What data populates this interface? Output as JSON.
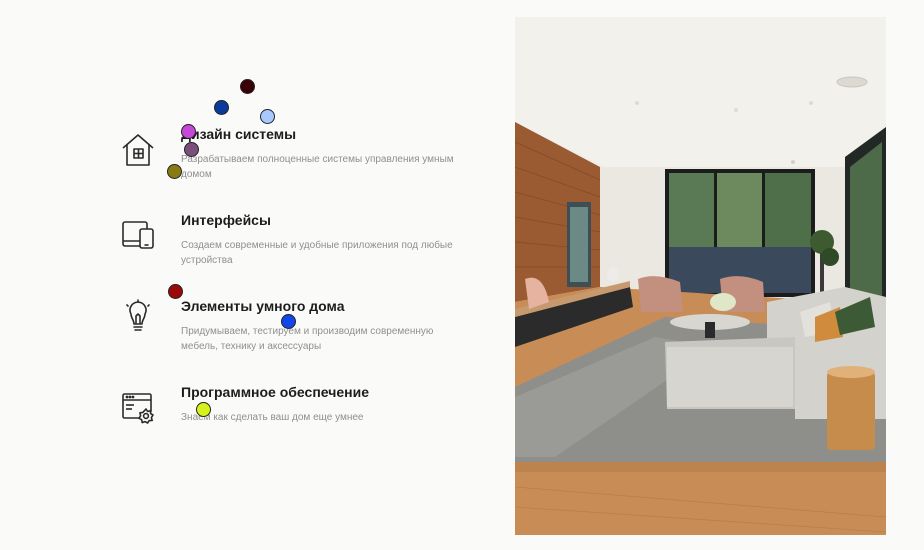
{
  "features": [
    {
      "icon": "house-icon",
      "title": "Дизайн системы",
      "description": "Разрабатываем полноценные системы управления умным домом"
    },
    {
      "icon": "devices-icon",
      "title": "Интерфейсы",
      "description": "Создаем современные и удобные приложения под любые устройства"
    },
    {
      "icon": "lightbulb-icon",
      "title": "Элементы умного дома",
      "description": "Придумываем, тестируем и производим современную мебель, технику и аксессуары"
    },
    {
      "icon": "browser-settings-icon",
      "title": "Программное обеспечение",
      "description": "Знаем как сделать ваш дом еще умнее"
    }
  ],
  "image": {
    "subject": "living-room-photo"
  },
  "markers": [
    {
      "color": "#3a0008"
    },
    {
      "color": "#0a3a9a"
    },
    {
      "color": "#a8c8ff"
    },
    {
      "color": "#c548d6"
    },
    {
      "color": "#7a4f7a"
    },
    {
      "color": "#8a7a12"
    },
    {
      "color": "#9a0a0a"
    },
    {
      "color": "#1246e8"
    },
    {
      "color": "#d6f21a"
    }
  ]
}
